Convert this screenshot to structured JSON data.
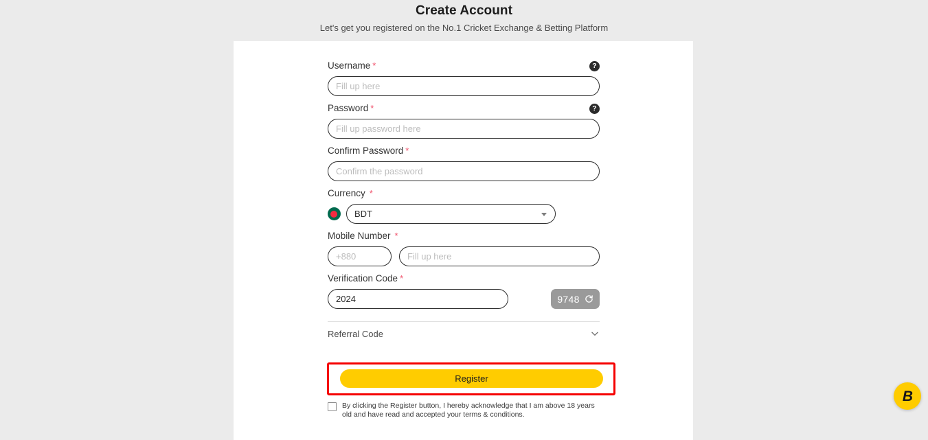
{
  "header": {
    "title": "Create Account",
    "subtitle": "Let's get you registered on the No.1 Cricket Exchange & Betting Platform"
  },
  "form": {
    "username": {
      "label": "Username",
      "required_mark": "*",
      "placeholder": "Fill up here",
      "value": "",
      "help_icon": "help-circle-icon",
      "help_glyph": "?"
    },
    "password": {
      "label": "Password",
      "required_mark": "*",
      "placeholder": "Fill up password here",
      "value": "",
      "help_icon": "help-circle-icon",
      "help_glyph": "?"
    },
    "confirm_password": {
      "label": "Confirm Password",
      "required_mark": "*",
      "placeholder": "Confirm the password",
      "value": ""
    },
    "currency": {
      "label": "Currency",
      "required_mark": "*",
      "selected": "BDT",
      "flag_icon": "bangladesh-flag-icon",
      "caret_icon": "dropdown-caret-icon",
      "options": [
        "BDT"
      ]
    },
    "mobile_number": {
      "label": "Mobile Number",
      "required_mark": "*",
      "country_code_placeholder": "+880",
      "country_code_value": "",
      "placeholder": "Fill up here",
      "value": ""
    },
    "verification_code": {
      "label": "Verification Code",
      "required_mark": "*",
      "value": "2024",
      "placeholder": "",
      "captcha_text": "9748",
      "refresh_icon": "refresh-icon"
    },
    "referral_code": {
      "label": "Referral Code",
      "chevron_icon": "chevron-down-icon"
    },
    "register_button": {
      "label": "Register"
    },
    "terms": {
      "checked": false,
      "text": "By clicking the Register button, I hereby acknowledge that I am above 18 years old and have read and accepted your terms & conditions."
    }
  },
  "fab": {
    "logo_glyph": "B",
    "name": "brand-logo-fab"
  },
  "colors": {
    "page_background": "#ebebeb",
    "card_background": "#ffffff",
    "accent_yellow": "#ffcc00",
    "required_red": "#f0536c",
    "highlight_red": "#f50000",
    "captcha_gray": "#9a9a9a",
    "flag_green": "#006a4e",
    "flag_red": "#f42a41"
  }
}
